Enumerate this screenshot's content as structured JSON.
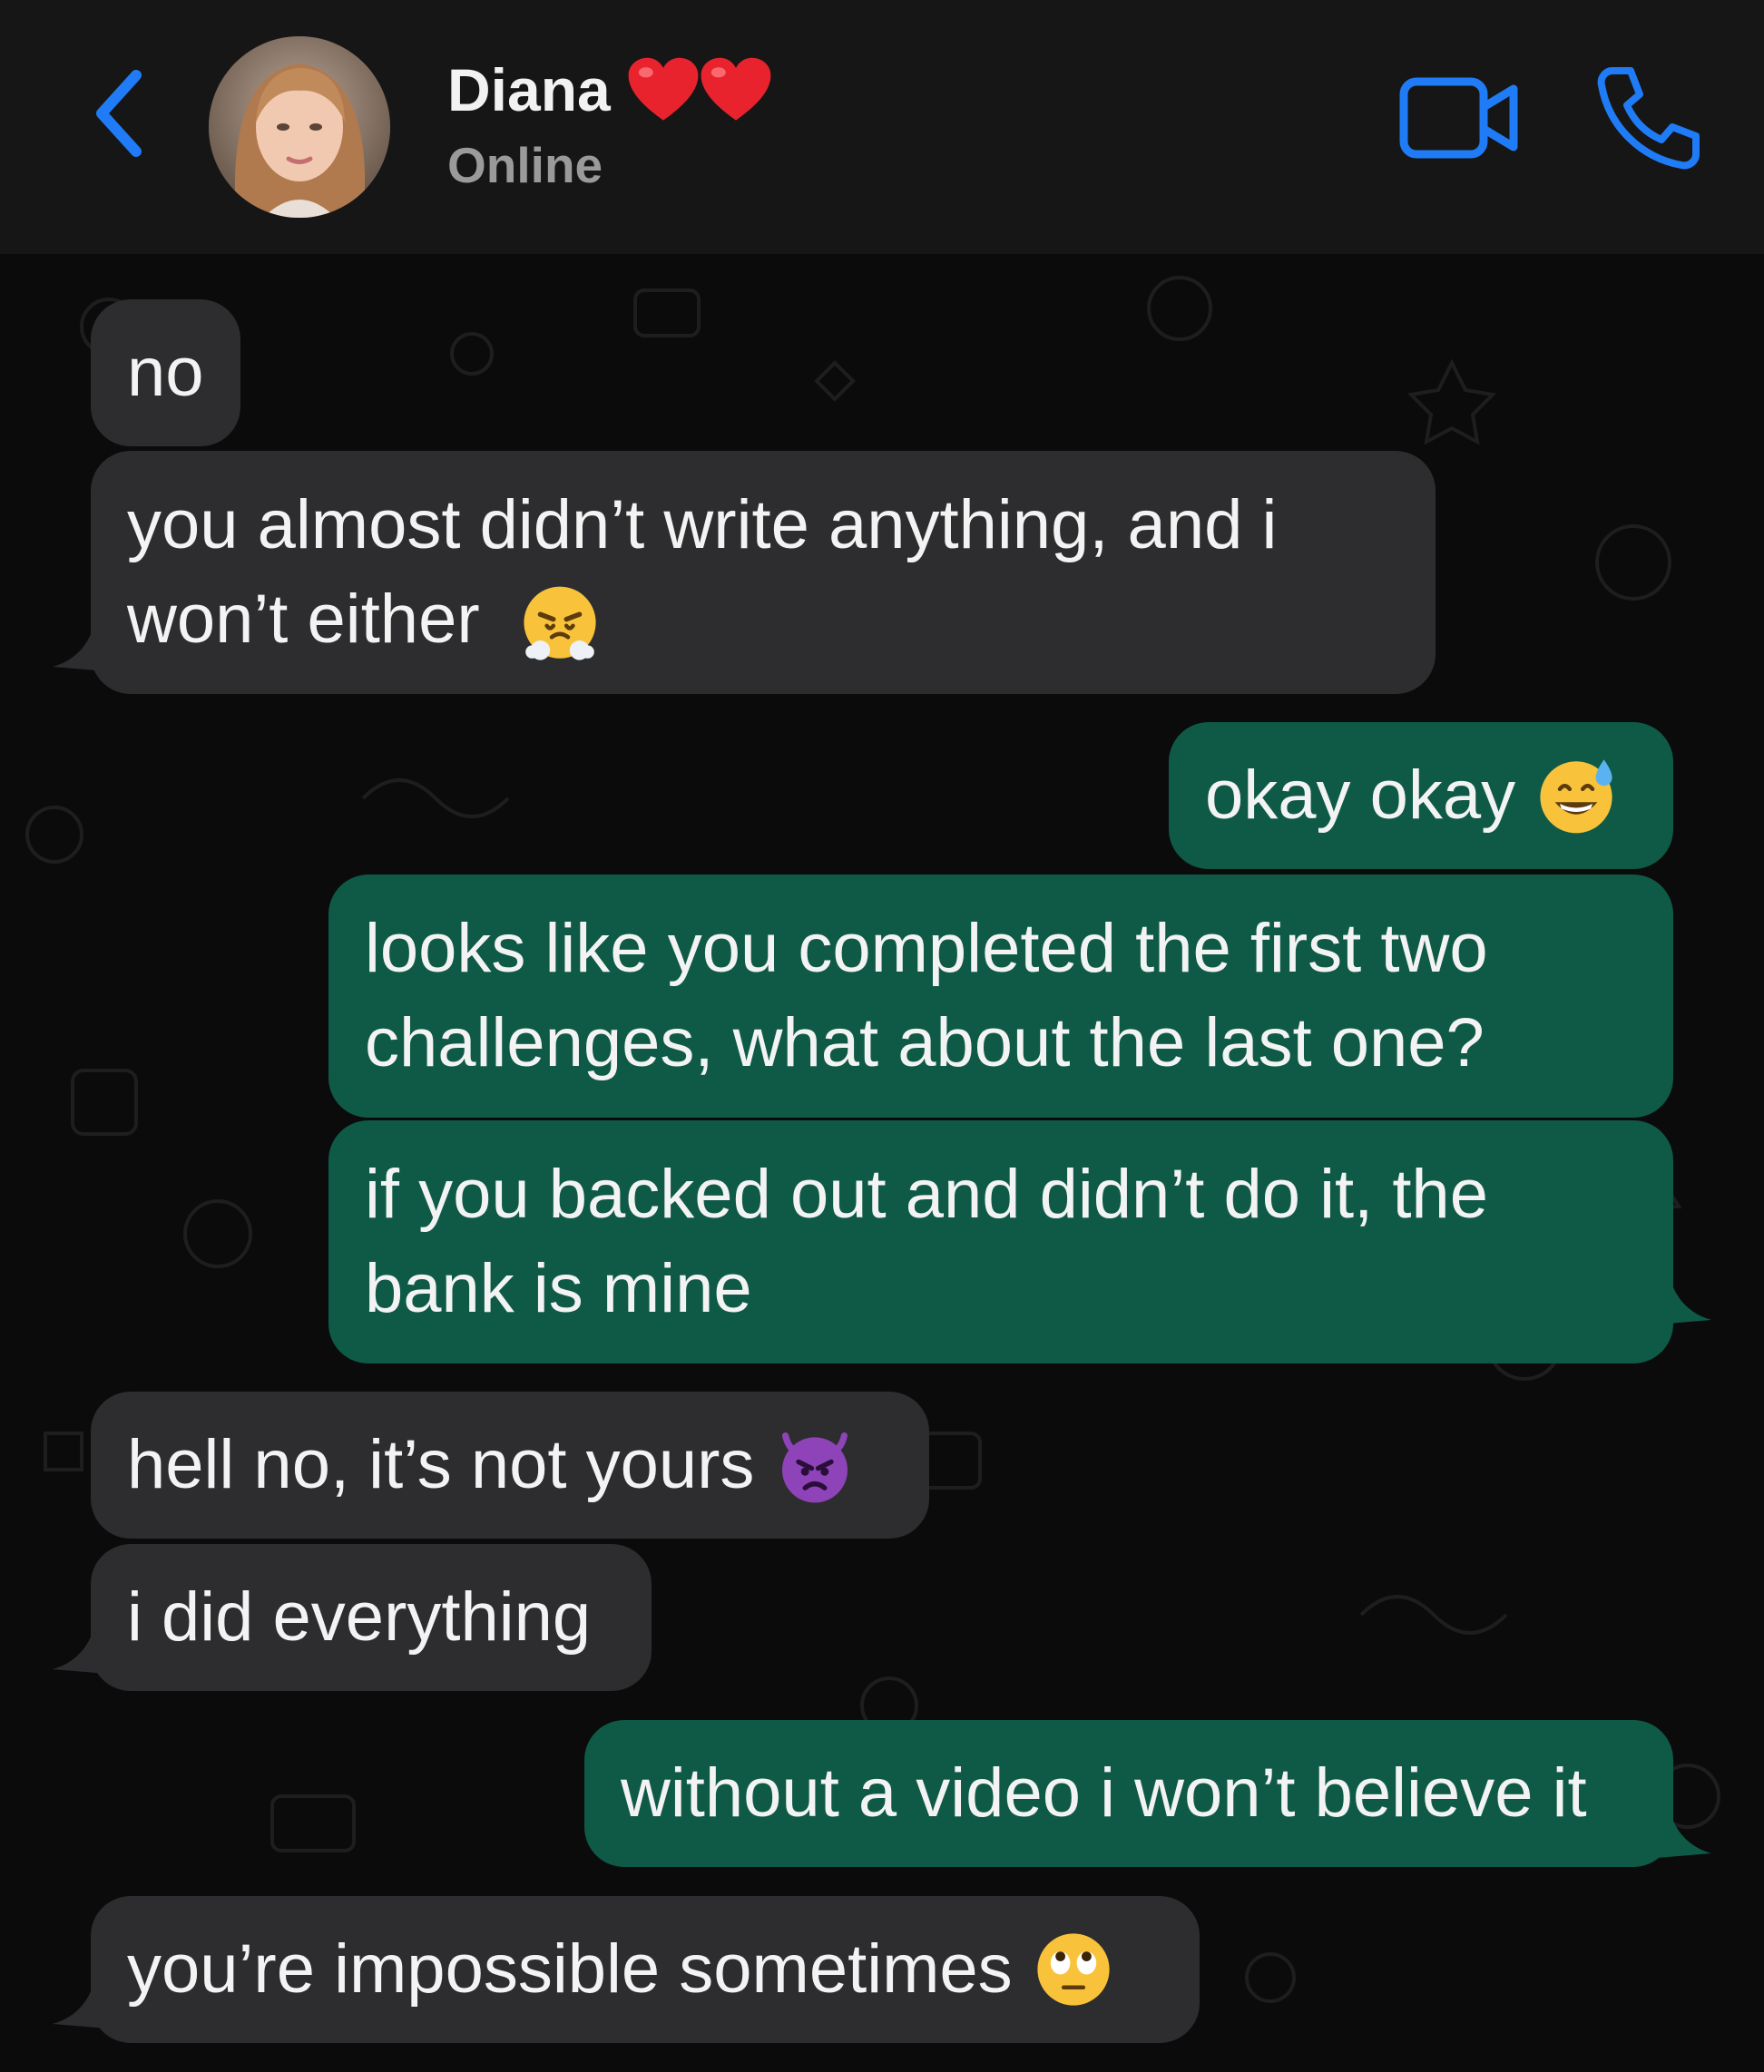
{
  "header": {
    "contact_name": "Diana",
    "status": "Online",
    "back_icon": "chevron-left-icon",
    "video_icon": "video-camera-icon",
    "call_icon": "phone-icon",
    "accent_color": "#1f7cf6"
  },
  "messages": [
    {
      "direction": "incoming",
      "lines": [
        "no"
      ]
    },
    {
      "direction": "incoming",
      "lines": [
        "you almost didn’t write anything, and i",
        "won’t either"
      ],
      "emoji": "steam-from-nose-face"
    },
    {
      "direction": "outgoing",
      "lines": [
        "okay okay"
      ],
      "emoji": "grinning-face-with-sweat"
    },
    {
      "direction": "outgoing",
      "lines": [
        "looks like you completed the first two",
        "challenges, what about the last one?"
      ]
    },
    {
      "direction": "outgoing",
      "lines": [
        "if you backed out and didn’t do it, the",
        "bank is mine"
      ]
    },
    {
      "direction": "incoming",
      "lines": [
        "hell no, it’s not yours"
      ],
      "emoji": "angry-devil-face"
    },
    {
      "direction": "incoming",
      "lines": [
        "i did everything"
      ]
    },
    {
      "direction": "outgoing",
      "lines": [
        "without a video i won’t believe it"
      ]
    },
    {
      "direction": "incoming",
      "lines": [
        "you’re impossible sometimes"
      ],
      "emoji": "eye-roll-face"
    }
  ],
  "colors": {
    "incoming_bubble": "#2d2d2f",
    "outgoing_bubble": "#0e5a47",
    "header_bg": "#161616",
    "chat_bg": "#0b0b0b"
  }
}
